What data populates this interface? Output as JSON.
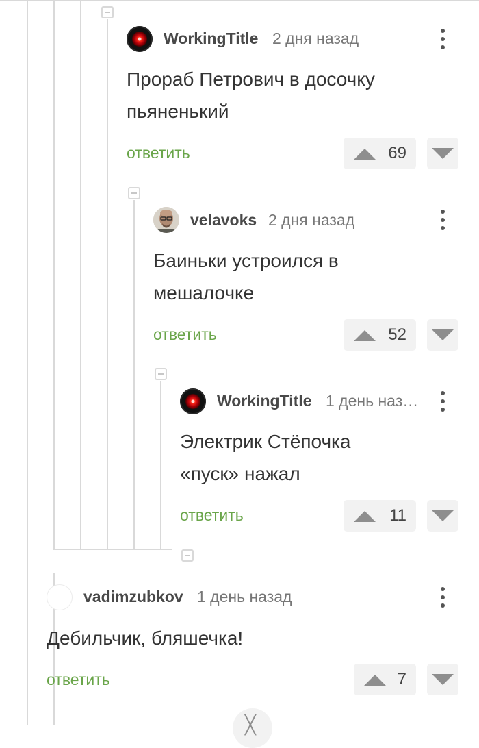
{
  "comments": [
    {
      "author": "WorkingTitle",
      "time": "2 дня назад",
      "avatar": "hal-9000-eye",
      "lines": [
        "Прораб Петрович в досочку",
        "пьяненький"
      ],
      "reply_label": "ответить",
      "score": "69"
    },
    {
      "author": "velavoks",
      "time": "2 дня назад",
      "avatar": "bald-man-glasses",
      "lines": [
        "Баиньки устроился в",
        "мешалочке"
      ],
      "reply_label": "ответить",
      "score": "52"
    },
    {
      "author": "WorkingTitle",
      "time": "1 день наз…",
      "avatar": "hal-9000-eye",
      "lines": [
        "Электрик Стёпочка",
        "«пуск» нажал"
      ],
      "reply_label": "ответить",
      "score": "11"
    },
    {
      "author": "vadimzubkov",
      "time": "1 день назад",
      "avatar": "empty",
      "lines": [
        "Дебильчик, бляшечка!"
      ],
      "reply_label": "ответить",
      "score": "7"
    }
  ],
  "icons": {
    "upvote": "up-arrow-icon",
    "downvote": "down-arrow-icon",
    "menu": "kebab-menu-icon",
    "collapse": "minus-square-icon",
    "more": "chevron-down-icon"
  },
  "colors": {
    "reply": "#6aa54a",
    "thread_line": "#d9d9d9",
    "vote_bg": "#f2f2f2",
    "arrow": "#8e8e8e"
  }
}
